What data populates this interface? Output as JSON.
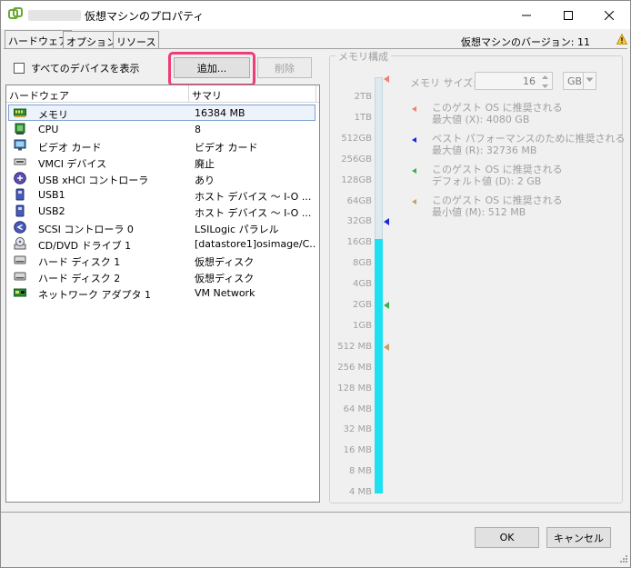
{
  "window": {
    "title": "仮想マシンのプロパティ",
    "controls": {
      "minimize": "—",
      "maximize": "☐",
      "close": "✕"
    }
  },
  "tabs": [
    {
      "label": "ハードウェア",
      "active": true
    },
    {
      "label": "オプション",
      "active": false
    },
    {
      "label": "リソース",
      "active": false
    }
  ],
  "version_label": "仮想マシンのバージョン: 11",
  "show_all_devices_label": "すべてのデバイスを表示",
  "buttons": {
    "add": "追加...",
    "remove": "削除",
    "ok": "OK",
    "cancel": "キャンセル"
  },
  "hardware_table": {
    "headers": [
      "ハードウェア",
      "サマリ"
    ],
    "rows": [
      {
        "name": "メモリ",
        "summary": "16384 MB",
        "icon": "memory-icon",
        "selected": true
      },
      {
        "name": "CPU",
        "summary": "8",
        "icon": "cpu-icon"
      },
      {
        "name": "ビデオ カード",
        "summary": "ビデオ カード",
        "icon": "monitor-icon"
      },
      {
        "name": "VMCI デバイス",
        "summary": "廃止",
        "icon": "vmci-device-icon"
      },
      {
        "name": "USB xHCI コントローラ",
        "summary": "あり",
        "icon": "usb-controller-icon"
      },
      {
        "name": "USB1",
        "summary": "ホスト デバイス 〜 I-O ...",
        "icon": "usb-device-icon"
      },
      {
        "name": "USB2",
        "summary": "ホスト デバイス 〜 I-O ...",
        "icon": "usb-device-icon"
      },
      {
        "name": "SCSI コントローラ 0",
        "summary": "LSILogic パラレル",
        "icon": "scsi-controller-icon"
      },
      {
        "name": "CD/DVD ドライブ 1",
        "summary": "[datastore1]osimage/C...",
        "icon": "cd-dvd-icon"
      },
      {
        "name": "ハード ディスク 1",
        "summary": "仮想ディスク",
        "icon": "hard-disk-icon"
      },
      {
        "name": "ハード ディスク 2",
        "summary": "仮想ディスク",
        "icon": "hard-disk-icon"
      },
      {
        "name": "ネットワーク アダプタ 1",
        "summary": "VM Network",
        "icon": "network-adapter-icon"
      }
    ]
  },
  "memory_config": {
    "legend": "メモリ構成",
    "size_label": "メモリ サイズ:",
    "size_value": "16",
    "unit": "GB",
    "scale_labels": [
      "2TB",
      "1TB",
      "512GB",
      "256GB",
      "128GB",
      "64GB",
      "32GB",
      "16GB",
      "8GB",
      "4GB",
      "2GB",
      "1GB",
      "512 MB",
      "256 MB",
      "128 MB",
      "64 MB",
      "32 MB",
      "16 MB",
      "8 MB",
      "4 MB"
    ],
    "current_level": "16GB",
    "info": [
      {
        "line1": "このゲスト OS に推奨される",
        "line2": "最大値 (X): 4080 GB",
        "color": "#f08070"
      },
      {
        "line1": "ベスト パフォーマンスのために推奨される",
        "line2": "最大値 (R): 32736 MB",
        "color": "#1a2ad8"
      },
      {
        "line1": "このゲスト OS に推奨される",
        "line2": "デフォルト値 (D): 2 GB",
        "color": "#3cb04a"
      },
      {
        "line1": "このゲスト OS に推奨される",
        "line2": "最小値 (M): 512 MB",
        "color": "#c8a064"
      }
    ],
    "markers": [
      {
        "level": "2TB+",
        "color": "#f08070"
      },
      {
        "level": "32GB",
        "color": "#1a2ad8"
      },
      {
        "level": "2GB",
        "color": "#3cb04a"
      },
      {
        "level": "512 MB",
        "color": "#c8a064"
      }
    ]
  },
  "colors": {
    "accent_highlight": "#ee3c74",
    "bar_fill": "#1fe0f0",
    "selected_row": "#eef3fb"
  }
}
